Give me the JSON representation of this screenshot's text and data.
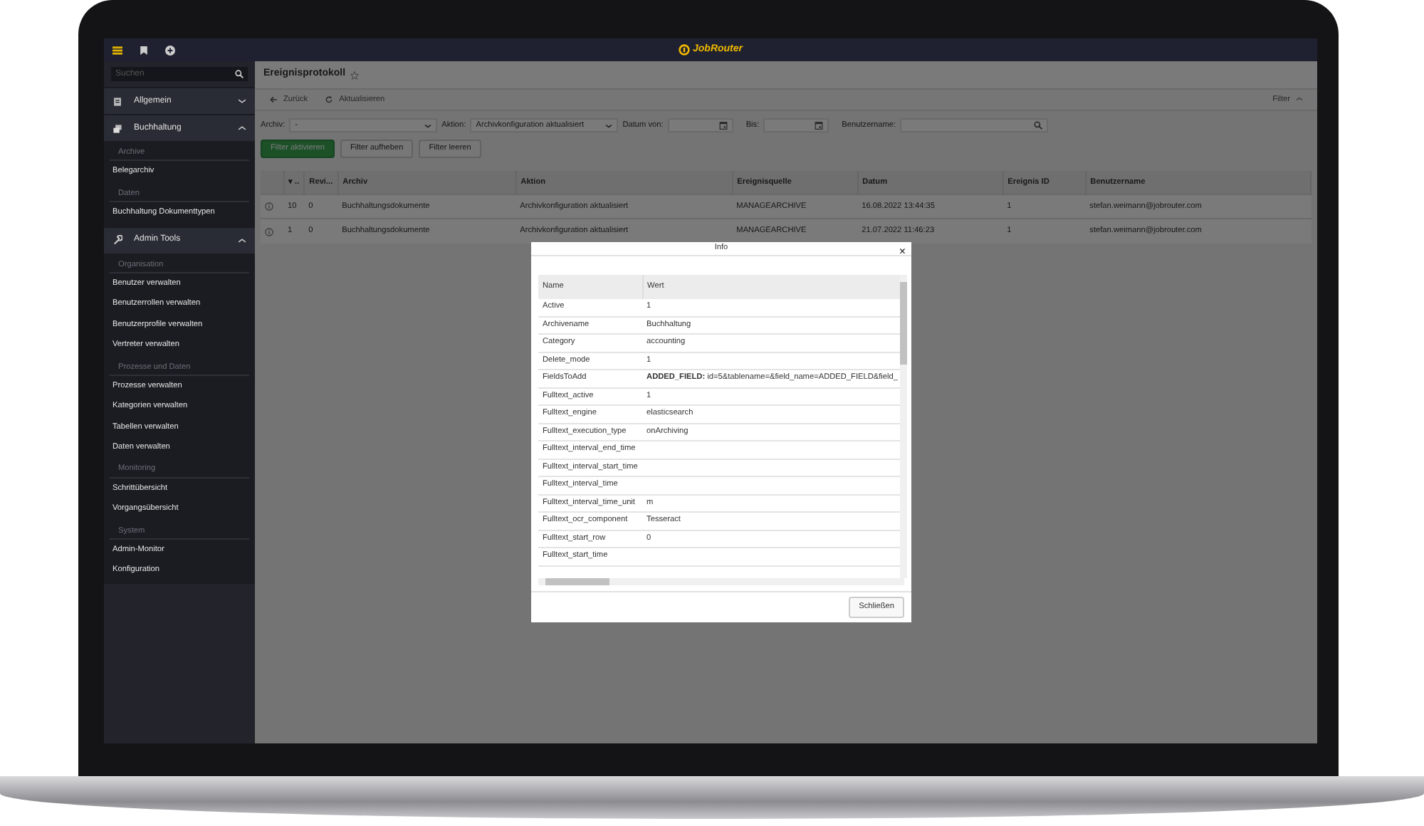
{
  "topbar": {
    "logo": "JobRouter"
  },
  "sidebar": {
    "search": {
      "placeholder": "Suchen"
    },
    "sections": [
      {
        "label": "Allgemein",
        "expanded": false
      },
      {
        "label": "Buchhaltung",
        "expanded": true,
        "groups": [
          {
            "heading": "Archive",
            "items": [
              "Belegarchiv"
            ]
          },
          {
            "heading": "Daten",
            "items": [
              "Buchhaltung Dokumenttypen"
            ]
          }
        ]
      },
      {
        "label": "Admin Tools",
        "expanded": true,
        "groups": [
          {
            "heading": "Organisation",
            "items": [
              "Benutzer verwalten",
              "Benutzerrollen verwalten",
              "Benutzerprofile verwalten",
              "Vertreter verwalten"
            ]
          },
          {
            "heading": "Prozesse und Daten",
            "items": [
              "Prozesse verwalten",
              "Kategorien verwalten",
              "Tabellen verwalten",
              "Daten verwalten"
            ]
          },
          {
            "heading": "Monitoring",
            "items": [
              "Schrittübersicht",
              "Vorgangsübersicht"
            ]
          },
          {
            "heading": "System",
            "items": [
              "Admin-Monitor",
              "Konfiguration"
            ]
          }
        ]
      }
    ]
  },
  "page": {
    "title": "Ereignisprotokoll",
    "favorite": false,
    "toolbar": [
      {
        "label": "Zurück"
      },
      {
        "label": "Aktualisieren"
      }
    ],
    "filter_toggle": "Filter",
    "filters": [
      {
        "label": "Archiv:",
        "kind": "select",
        "value": "-"
      },
      {
        "label": "Aktion:",
        "kind": "select",
        "value": "Archivkonfiguration aktualisiert"
      },
      {
        "label": "Datum von:",
        "kind": "date"
      },
      {
        "label": "Bis:",
        "kind": "date"
      },
      {
        "label": "Benutzername:",
        "kind": "search"
      }
    ],
    "buttons": [
      {
        "label": "Filter aktivieren",
        "primary": true
      },
      {
        "label": "Filter aufheben",
        "primary": false
      },
      {
        "label": "Filter leeren",
        "primary": false
      }
    ]
  },
  "table": {
    "columns": [
      "",
      "▾ ..",
      "Revi...",
      "Archiv",
      "Aktion",
      "Ereignisquelle",
      "Datum",
      "Ereignis ID",
      "Benutzername"
    ],
    "rows": [
      {
        "cells": [
          "",
          "10",
          "0",
          "Buchhaltungsdokumente",
          "Archivkonfiguration aktualisiert",
          "MANAGEARCHIVE",
          "16.08.2022 13:44:35",
          "1",
          "stefan.weimann@jobrouter.com"
        ]
      },
      {
        "cells": [
          "",
          "1",
          "0",
          "Buchhaltungsdokumente",
          "Archivkonfiguration aktualisiert",
          "MANAGEARCHIVE",
          "21.07.2022 11:46:23",
          "1",
          "stefan.weimann@jobrouter.com"
        ]
      }
    ]
  },
  "dialog": {
    "title": "Info",
    "close": "×",
    "columns": [
      "Name",
      "Wert"
    ],
    "rows": [
      [
        "Active",
        "1"
      ],
      [
        "Archivename",
        "Buchhaltung"
      ],
      [
        "Category",
        "accounting"
      ],
      [
        "Delete_mode",
        "1"
      ],
      [
        "FieldsToAdd",
        "**ADDED_FIELD:** id=5&tablename=&field_name=ADDED_FIELD&field_"
      ],
      [
        "Fulltext_active",
        "1"
      ],
      [
        "Fulltext_engine",
        "elasticsearch"
      ],
      [
        "Fulltext_execution_type",
        "onArchiving"
      ],
      [
        "Fulltext_interval_end_time",
        ""
      ],
      [
        "Fulltext_interval_start_time",
        ""
      ],
      [
        "Fulltext_interval_time",
        ""
      ],
      [
        "Fulltext_interval_time_unit",
        "m"
      ],
      [
        "Fulltext_ocr_component",
        "Tesseract"
      ],
      [
        "Fulltext_start_row",
        "0"
      ],
      [
        "Fulltext_start_time",
        ""
      ]
    ],
    "button": "Schließen"
  }
}
